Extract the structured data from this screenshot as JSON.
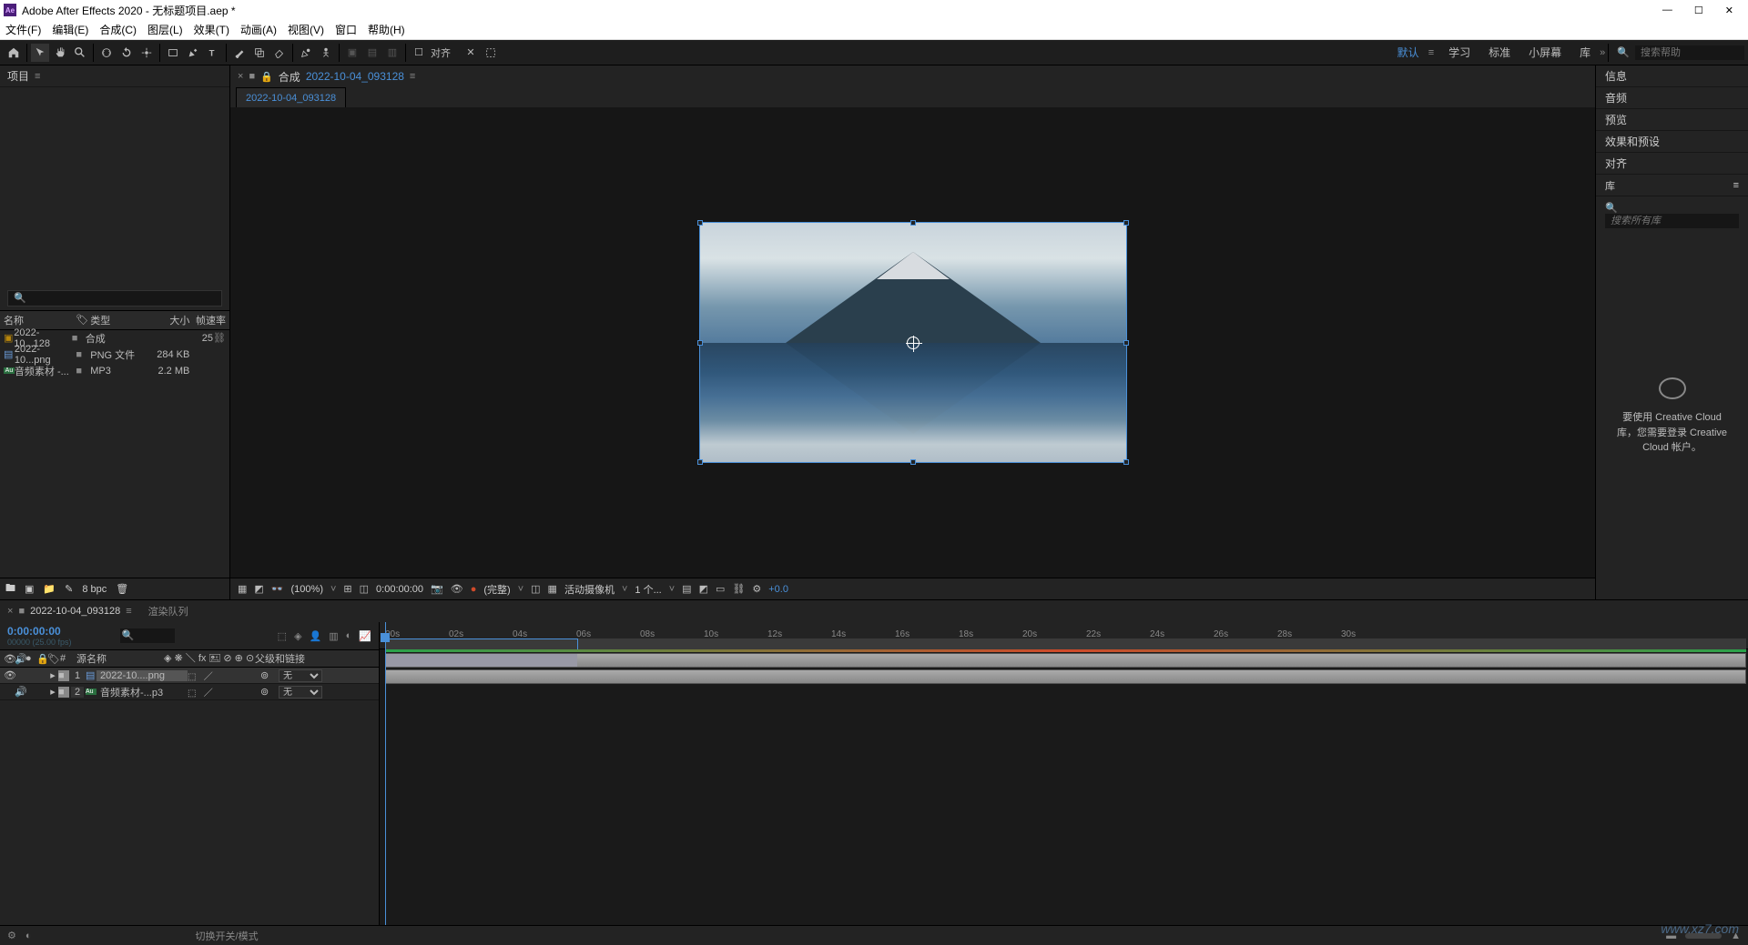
{
  "titlebar": {
    "app": "Ae",
    "title": "Adobe After Effects 2020 - 无标题项目.aep *"
  },
  "menubar": [
    "文件(F)",
    "编辑(E)",
    "合成(C)",
    "图层(L)",
    "效果(T)",
    "动画(A)",
    "视图(V)",
    "窗口",
    "帮助(H)"
  ],
  "toolbar_labels": {
    "snap": "对齐",
    "search_ph": "搜索帮助"
  },
  "workspaces": [
    {
      "label": "默认",
      "active": true
    },
    {
      "label": "学习",
      "active": false
    },
    {
      "label": "标准",
      "active": false
    },
    {
      "label": "小屏幕",
      "active": false
    },
    {
      "label": "库",
      "active": false
    }
  ],
  "project_panel": {
    "title": "项目",
    "search_ph": "",
    "headers": {
      "name": "名称",
      "type": "类型",
      "size": "大小",
      "fps": "帧速率"
    },
    "items": [
      {
        "icon": "comp",
        "name": "2022-10...128",
        "type": "合成",
        "size": "",
        "fps": "25"
      },
      {
        "icon": "png",
        "name": "2022-10...png",
        "type": "PNG 文件",
        "size": "284 KB",
        "fps": ""
      },
      {
        "icon": "au",
        "name": "音频素材 -...",
        "type": "MP3",
        "size": "2.2 MB",
        "fps": ""
      }
    ],
    "bpc": "8 bpc"
  },
  "composition": {
    "tab_label": "合成",
    "name": "2022-10-04_093128",
    "active_tab": "2022-10-04_093128"
  },
  "viewer_footer": {
    "zoom": "(100%)",
    "time": "0:00:00:00",
    "res": "(完整)",
    "camera": "活动摄像机",
    "views": "1 个...",
    "exposure": "+0.0"
  },
  "right_panel": {
    "items": [
      "信息",
      "音频",
      "预览",
      "效果和预设",
      "对齐"
    ],
    "library": "库",
    "search_ph": "搜索所有库",
    "cloud_text": "要使用 Creative Cloud 库，您需要登录 Creative Cloud 帐户。"
  },
  "timeline": {
    "tab_name": "2022-10-04_093128",
    "render_queue": "渲染队列",
    "time": "0:00:00:00",
    "fps": "00000 (25.00 fps)",
    "headers": {
      "source": "源名称",
      "parent": "父级和链接"
    },
    "layers": [
      {
        "num": "1",
        "name": "2022-10....png",
        "parent": "无",
        "selected": true
      },
      {
        "num": "2",
        "name": "音频素材-...p3",
        "parent": "无",
        "selected": false
      }
    ],
    "ruler": [
      "00s",
      "02s",
      "04s",
      "06s",
      "08s",
      "10s",
      "12s",
      "14s",
      "16s",
      "18s",
      "20s",
      "22s",
      "24s",
      "26s",
      "28s",
      "30s"
    ],
    "footer": "切换开关/模式"
  },
  "watermark": "www.xz7.com"
}
